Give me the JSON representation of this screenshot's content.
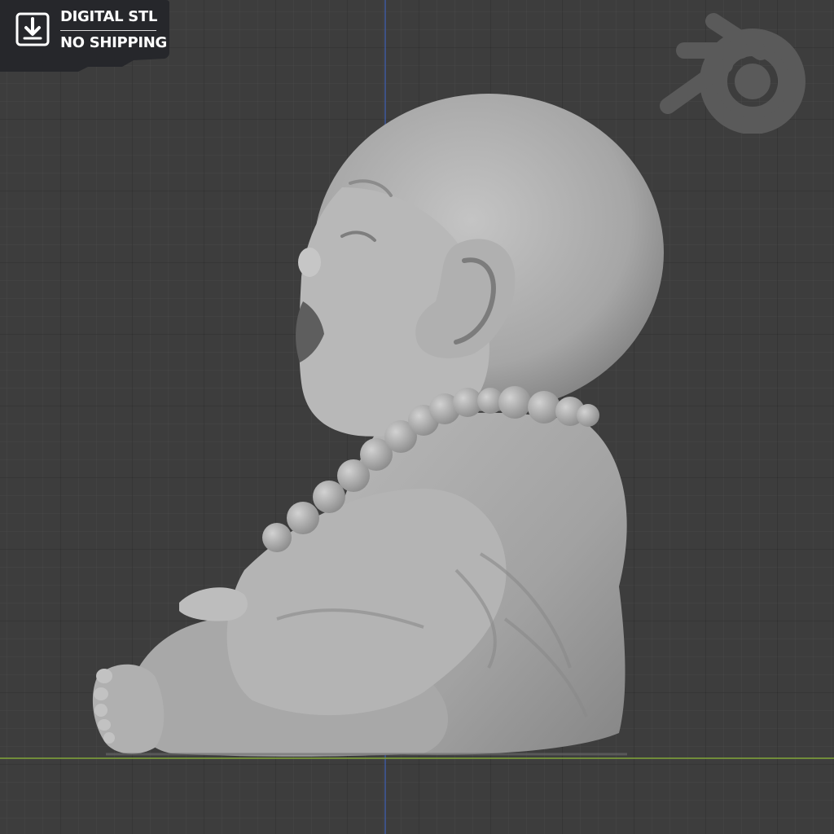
{
  "badge": {
    "line1": "DIGITAL STL",
    "line2": "NO SHIPPING",
    "icon": "download-icon",
    "background_color": "#26272b"
  },
  "viewport": {
    "background_color": "#3d3d3d",
    "grid": true,
    "y_axis_color": "#3f5a9e",
    "x_axis_color": "#7a9a3a"
  },
  "logo": {
    "icon": "blender-logo-icon",
    "color": "#5a5a5a"
  },
  "model": {
    "subject": "seated-monk-figurine",
    "color": "#a9a9a9"
  }
}
